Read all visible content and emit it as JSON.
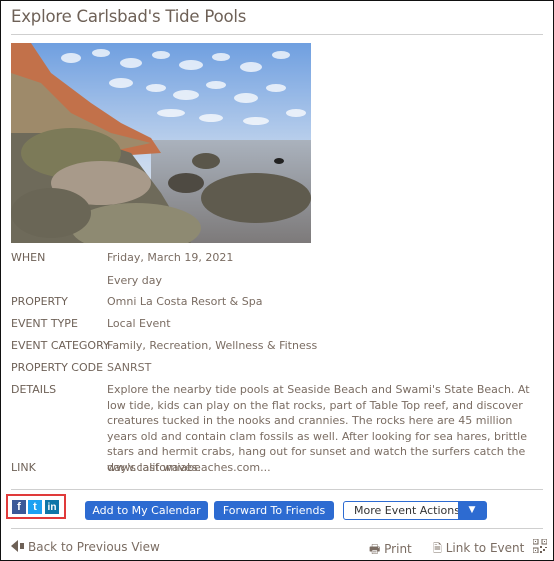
{
  "event": {
    "title": "Explore Carlsbad's Tide Pools",
    "image_alt": "Tide pools with rocks and cliffs at sunset beach",
    "fields": [
      {
        "label": "WHEN",
        "value": "Friday, March 19, 2021"
      },
      {
        "label": "",
        "value": "Every day"
      },
      {
        "label": "PROPERTY",
        "value": "Omni La Costa Resort & Spa"
      },
      {
        "label": "EVENT TYPE",
        "value": "Local Event"
      },
      {
        "label": "EVENT CATEGORY",
        "value": "Family, Recreation, Wellness & Fitness"
      },
      {
        "label": "PROPERTY CODE",
        "value": "SANRST"
      }
    ],
    "details_label": "DETAILS",
    "details": "Explore the nearby tide pools at Seaside Beach and Swami's State Beach. At low tide, kids can play on the flat rocks, part of Table Top reef, and discover creatures tucked in the nooks and crannies. The rocks here are 45 million years old and contain clam fossils as well. After looking for sea hares, brittle stars and hermit crabs, hang out for sunset and watch the surfers catch the day's last waves.",
    "link_label": "LINK",
    "link": "www.californiabeaches.com..."
  },
  "social": {
    "facebook": "f",
    "twitter": "t",
    "linkedin": "in"
  },
  "actions": {
    "add_calendar": "Add to My Calendar",
    "forward": "Forward To Friends",
    "more": "More Event Actions",
    "more_arrow": "▼"
  },
  "footer": {
    "back": "Back to Previous View",
    "print": "Print",
    "link_to_event": "Link to Event"
  },
  "colors": {
    "accent": "#2d6bd1",
    "text": "#6e6157",
    "highlight_box": "#e03a3a"
  }
}
